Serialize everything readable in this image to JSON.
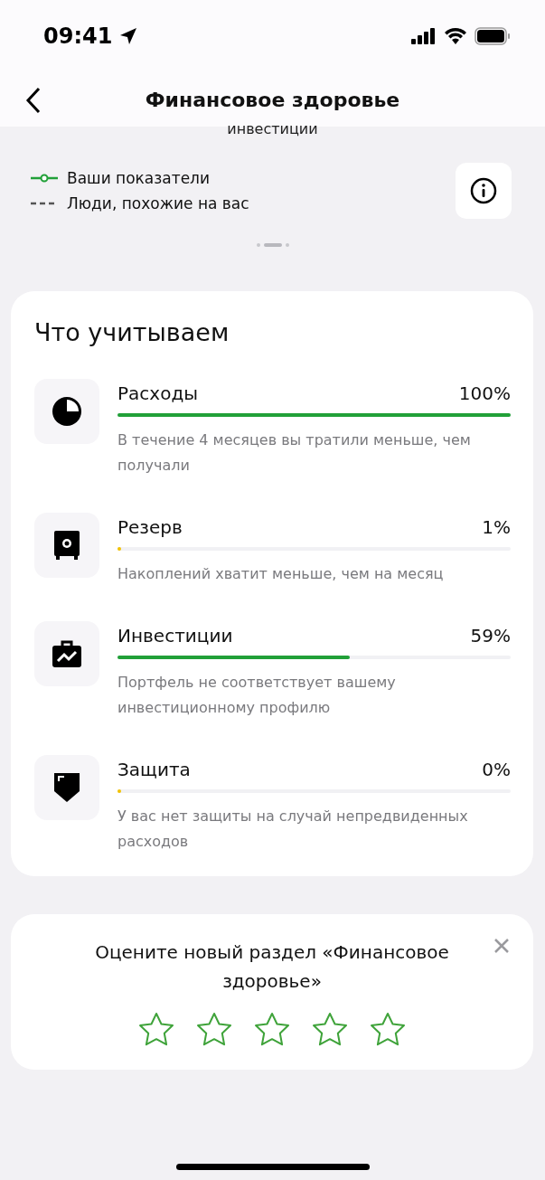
{
  "status_bar": {
    "time": "09:41"
  },
  "header": {
    "title": "Финансовое здоровье"
  },
  "chart_caption": "инвестиции",
  "legend": [
    {
      "kind": "line",
      "label": "Ваши показатели"
    },
    {
      "kind": "dashed",
      "label": "Люди, похожие на вас"
    }
  ],
  "pager": [
    {
      "selected": false
    },
    {
      "selected": true
    },
    {
      "selected": false
    }
  ],
  "factors_card": {
    "title": "Что учитываем",
    "items": [
      {
        "kind": "pie",
        "name": "Расходы",
        "value": "100%",
        "level": 1,
        "color": "#21a038",
        "description": "В течение 4 месяцев вы тратили меньше, чем получали"
      },
      {
        "kind": "safe",
        "name": "Резерв",
        "value": "1%",
        "level": 0.01,
        "color": "#f2c200",
        "description": "Накоплений хватит меньше, чем на месяц"
      },
      {
        "kind": "briefcase",
        "name": "Инвестиции",
        "value": "59%",
        "level": 0.59,
        "color": "#21a038",
        "description": "Портфель не соответствует вашему инвестиционному профилю"
      },
      {
        "kind": "shield",
        "name": "Защита",
        "value": "0%",
        "level": 0,
        "color": "#f2c200",
        "description": "У вас нет защиты на случай непредвиденных расходов"
      }
    ]
  },
  "rating_card": {
    "text": "Оцените новый раздел «Финансовое здоровье»",
    "stars": 0
  }
}
